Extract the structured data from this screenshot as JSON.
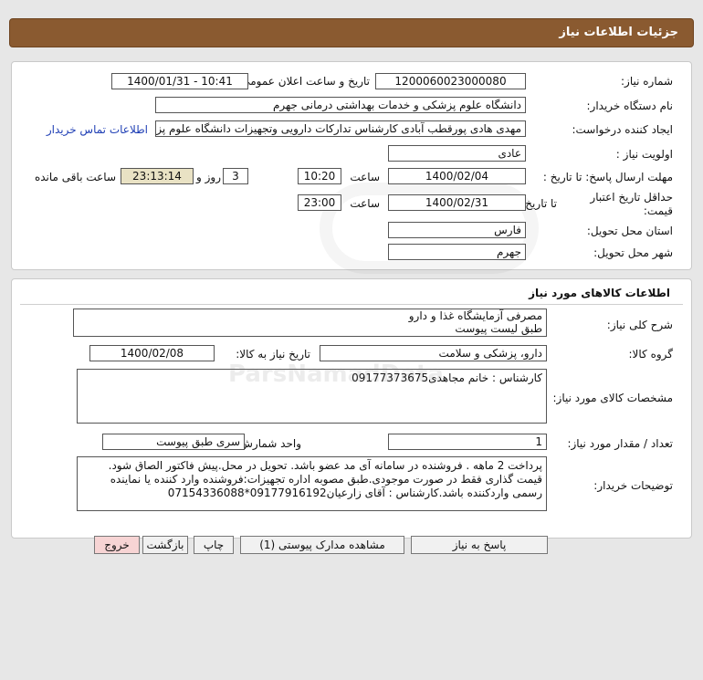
{
  "header": {
    "title": "جزئیات اطلاعات نیاز"
  },
  "general": {
    "need_number_label": "شماره نیاز:",
    "need_number": "1200060023000080",
    "announce_label": "تاریخ و ساعت اعلان عمومی:",
    "announce_value": "1400/01/31 - 10:41",
    "buyer_label": "نام دستگاه خریدار:",
    "buyer_value": "دانشگاه علوم پزشکی و خدمات بهداشتی درمانی جهرم",
    "requester_label": "ایجاد کننده درخواست:",
    "requester_value": "مهدی هادی پورقطب آبادی کارشناس تدارکات دارویی وتجهیزات دانشگاه علوم پزشکی",
    "contact_link": "اطلاعات تماس خریدار",
    "priority_label": "اولویت نیاز :",
    "priority_value": "عادی",
    "deadline_label": "مهلت ارسال پاسخ: تا تاریخ :",
    "deadline_date": "1400/02/04",
    "time_label": "ساعت",
    "deadline_time": "10:20",
    "days_value": "3",
    "days_label": "روز و",
    "remaining_value": "23:13:14",
    "remaining_label": "ساعت باقی مانده",
    "validity_label_1": "حداقل تاریخ اعتبار",
    "validity_label_2": "قیمت:",
    "validity_to_label": "تا تاریخ :",
    "validity_date": "1400/02/31",
    "validity_time": "23:00",
    "province_label": "استان محل تحویل:",
    "province_value": "فارس",
    "city_label": "شهر محل تحویل:",
    "city_value": "جهرم"
  },
  "goods": {
    "section_title": "اطلاعات کالاهای مورد نیاز",
    "desc_label": "شرح کلی نیاز:",
    "desc_line1": "مصرفی آزمایشگاه غذا و دارو",
    "desc_line2": "طبق لیست پیوست",
    "group_label": "گروه کالا:",
    "group_value": "دارو، پزشکی و سلامت",
    "need_date_label": "تاریخ نیاز به کالا:",
    "need_date_value": "1400/02/08",
    "spec_label": "مشخصات کالای مورد نیاز:",
    "spec_value": "کارشناس : خانم  مجاهدی09177373675",
    "qty_label": "تعداد / مقدار مورد نیاز:",
    "qty_value": "1",
    "unit_label": "واحد شمارش:",
    "unit_value": "سری طبق پیوست",
    "notes_label": "توضیحات خریدار:",
    "notes_value": "پرداخت 2 ماهه . فروشنده در سامانه آی مد عضو باشد. تحویل در محل.پیش فاکتور الصاق شود. قیمت گذاری فقط در صورت موجودی.طبق مصوبه اداره تجهیزات:فروشنده وارد کننده یا نماینده رسمی واردکننده باشد.کارشناس : آقای زارعیان09177916192*07154336088"
  },
  "buttons": {
    "reply": "پاسخ به نیاز",
    "attachments": "مشاهده مدارک پیوستی (1)",
    "print": "چاپ",
    "back": "بازگشت",
    "exit": "خروج"
  }
}
